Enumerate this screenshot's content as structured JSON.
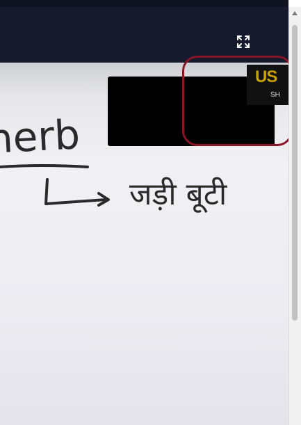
{
  "header": {
    "fullscreen_icon": "expand-arrows-icon"
  },
  "video": {
    "handwritten_english": "herb",
    "handwritten_hindi": "जड़ी बूटी",
    "logo_mark": "US",
    "logo_text": "SH"
  },
  "colors": {
    "header_bg": "#151b2d",
    "highlight_ring": "#8a1526",
    "scroll_thumb": "#c1c1c1"
  }
}
